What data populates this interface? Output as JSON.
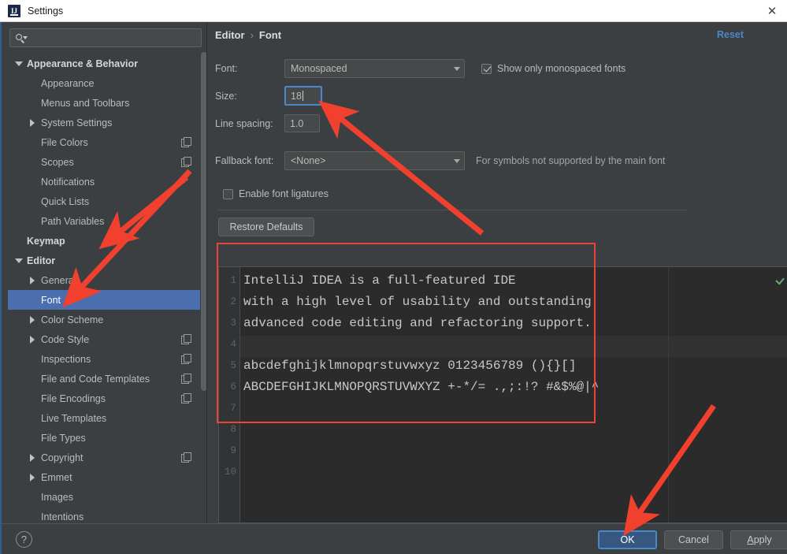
{
  "window": {
    "title": "Settings",
    "logo_text": "IJ",
    "close_label": "✕"
  },
  "sidebar": {
    "search": {
      "value": "",
      "placeholder": ""
    },
    "items": [
      {
        "label": "Appearance & Behavior",
        "indent": 0,
        "twisty": "down",
        "root": true,
        "selected": false,
        "copy": false
      },
      {
        "label": "Appearance",
        "indent": 1,
        "twisty": "none",
        "root": false,
        "selected": false,
        "copy": false
      },
      {
        "label": "Menus and Toolbars",
        "indent": 1,
        "twisty": "none",
        "root": false,
        "selected": false,
        "copy": false
      },
      {
        "label": "System Settings",
        "indent": 1,
        "twisty": "right",
        "root": false,
        "selected": false,
        "copy": false
      },
      {
        "label": "File Colors",
        "indent": 1,
        "twisty": "none",
        "root": false,
        "selected": false,
        "copy": true
      },
      {
        "label": "Scopes",
        "indent": 1,
        "twisty": "none",
        "root": false,
        "selected": false,
        "copy": true
      },
      {
        "label": "Notifications",
        "indent": 1,
        "twisty": "none",
        "root": false,
        "selected": false,
        "copy": false
      },
      {
        "label": "Quick Lists",
        "indent": 1,
        "twisty": "none",
        "root": false,
        "selected": false,
        "copy": false
      },
      {
        "label": "Path Variables",
        "indent": 1,
        "twisty": "none",
        "root": false,
        "selected": false,
        "copy": false
      },
      {
        "label": "Keymap",
        "indent": 0,
        "twisty": "none",
        "root": true,
        "selected": false,
        "copy": false
      },
      {
        "label": "Editor",
        "indent": 0,
        "twisty": "down",
        "root": true,
        "selected": false,
        "copy": false
      },
      {
        "label": "General",
        "indent": 1,
        "twisty": "right",
        "root": false,
        "selected": false,
        "copy": false
      },
      {
        "label": "Font",
        "indent": 1,
        "twisty": "none",
        "root": false,
        "selected": true,
        "copy": false
      },
      {
        "label": "Color Scheme",
        "indent": 1,
        "twisty": "right",
        "root": false,
        "selected": false,
        "copy": false
      },
      {
        "label": "Code Style",
        "indent": 1,
        "twisty": "right",
        "root": false,
        "selected": false,
        "copy": true
      },
      {
        "label": "Inspections",
        "indent": 1,
        "twisty": "none",
        "root": false,
        "selected": false,
        "copy": true
      },
      {
        "label": "File and Code Templates",
        "indent": 1,
        "twisty": "none",
        "root": false,
        "selected": false,
        "copy": true
      },
      {
        "label": "File Encodings",
        "indent": 1,
        "twisty": "none",
        "root": false,
        "selected": false,
        "copy": true
      },
      {
        "label": "Live Templates",
        "indent": 1,
        "twisty": "none",
        "root": false,
        "selected": false,
        "copy": false
      },
      {
        "label": "File Types",
        "indent": 1,
        "twisty": "none",
        "root": false,
        "selected": false,
        "copy": false
      },
      {
        "label": "Copyright",
        "indent": 1,
        "twisty": "right",
        "root": false,
        "selected": false,
        "copy": true
      },
      {
        "label": "Emmet",
        "indent": 1,
        "twisty": "right",
        "root": false,
        "selected": false,
        "copy": false
      },
      {
        "label": "Images",
        "indent": 1,
        "twisty": "none",
        "root": false,
        "selected": false,
        "copy": false
      },
      {
        "label": "Intentions",
        "indent": 1,
        "twisty": "none",
        "root": false,
        "selected": false,
        "copy": false
      }
    ]
  },
  "main": {
    "breadcrumb": {
      "parent": "Editor",
      "separator": "›",
      "current": "Font"
    },
    "reset_label": "Reset",
    "fields": {
      "font_label": "Font:",
      "font_value": "Monospaced",
      "size_label": "Size:",
      "size_value": "18",
      "line_spacing_label": "Line spacing:",
      "line_spacing_value": "1.0",
      "fallback_label": "Fallback font:",
      "fallback_value": "<None>",
      "fallback_hint": "For symbols not supported by the main font"
    },
    "checkboxes": {
      "monospaced_label": "Show only monospaced fonts",
      "monospaced_checked": true,
      "ligatures_label": "Enable font ligatures",
      "ligatures_checked": false
    },
    "restore_defaults_label": "Restore Defaults"
  },
  "preview": {
    "lines": [
      {
        "num": "1",
        "text": "IntelliJ IDEA is a full-featured IDE"
      },
      {
        "num": "2",
        "text": "with a high level of usability and outstanding"
      },
      {
        "num": "3",
        "text": "advanced code editing and refactoring support."
      },
      {
        "num": "4",
        "text": ""
      },
      {
        "num": "5",
        "text": "abcdefghijklmnopqrstuvwxyz 0123456789 (){}[]"
      },
      {
        "num": "6",
        "text": "ABCDEFGHIJKLMNOPQRSTUVWXYZ +-*/= .,;:!? #&$%@|^"
      },
      {
        "num": "7",
        "text": ""
      },
      {
        "num": "8",
        "text": ""
      },
      {
        "num": "9",
        "text": ""
      },
      {
        "num": "10",
        "text": ""
      }
    ],
    "caret_line_index": 3,
    "status_icon": "green-check-icon"
  },
  "buttons": {
    "ok": "OK",
    "cancel": "Cancel",
    "apply_prefix": "A",
    "apply_suffix": "pply",
    "help": "?"
  },
  "colors": {
    "accent_blue": "#4b6eaf",
    "link_blue": "#4a88c7",
    "annotation_red": "#e8443a",
    "panel_bg": "#3c3f41",
    "editor_bg": "#2b2b2b"
  }
}
